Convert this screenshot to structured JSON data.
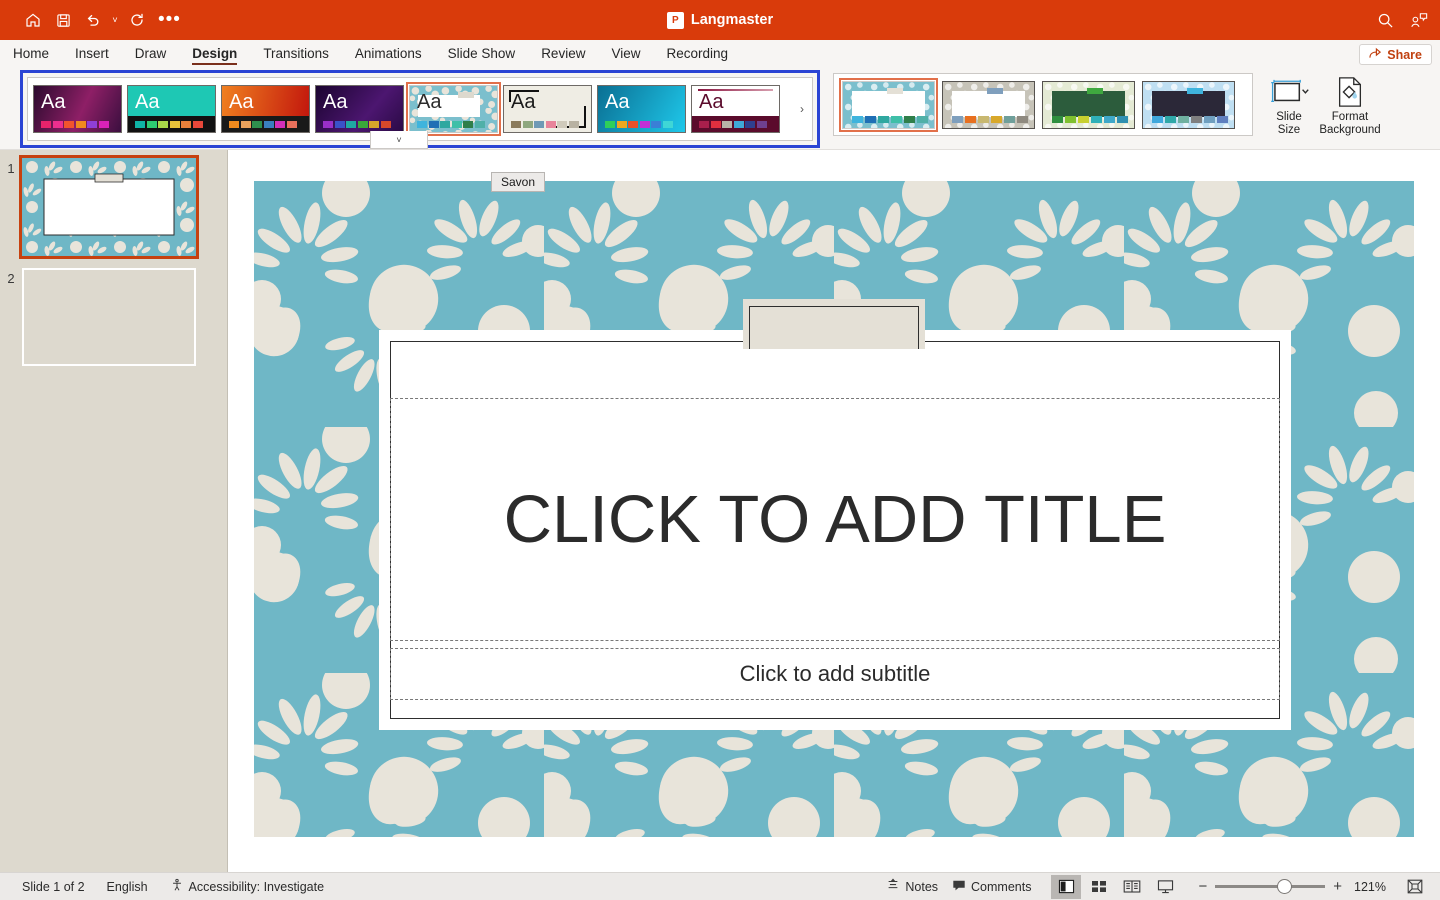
{
  "titlebar": {
    "title": "Langmaster",
    "app_icon": "powerpoint-icon",
    "quick_access": [
      {
        "name": "home-icon",
        "label": "Home"
      },
      {
        "name": "save-icon",
        "label": "Save"
      },
      {
        "name": "undo-icon",
        "label": "Undo"
      },
      {
        "name": "undo-dropdown-caret",
        "label": "˅"
      },
      {
        "name": "redo-icon",
        "label": "Redo"
      },
      {
        "name": "more-options-icon",
        "label": "•••"
      }
    ],
    "right_icons": [
      {
        "name": "search-icon",
        "label": "Search"
      },
      {
        "name": "collaborators-icon",
        "label": "Collaborators"
      }
    ],
    "bg_color": "#d93b0b"
  },
  "tabs": [
    {
      "label": "Home",
      "active": false
    },
    {
      "label": "Insert",
      "active": false
    },
    {
      "label": "Draw",
      "active": false
    },
    {
      "label": "Design",
      "active": true
    },
    {
      "label": "Transitions",
      "active": false
    },
    {
      "label": "Animations",
      "active": false
    },
    {
      "label": "Slide Show",
      "active": false
    },
    {
      "label": "Review",
      "active": false
    },
    {
      "label": "View",
      "active": false
    },
    {
      "label": "Recording",
      "active": false
    }
  ],
  "share": {
    "label": "Share",
    "icon": "share-icon",
    "color": "#c0400f"
  },
  "ribbon": {
    "themes": {
      "focused": true,
      "focus_ring_color": "#2b44d4",
      "sample_text": "Aa",
      "more_caret": "˅",
      "next_arrow": "›",
      "tooltip": "Savon",
      "items": [
        {
          "name": "theme-berry",
          "bg": "linear-gradient(115deg,#2b0a2e,#8e1f66 55%,#3b0f3f)",
          "aa_color": "#ffffff",
          "swatches": [
            "#e8236b",
            "#ec2f8e",
            "#f2542d",
            "#f08a1e",
            "#8f3fd6",
            "#d922b8"
          ]
        },
        {
          "name": "theme-teal-facet",
          "bg": "#1ec8b4",
          "aa_color": "#ffffff",
          "swatches": [
            "#0fb5a5",
            "#2ecc71",
            "#a8d84a",
            "#e8c23a",
            "#e8803a",
            "#e8483a"
          ],
          "band": "#111111"
        },
        {
          "name": "theme-orange-ion",
          "bg": "linear-gradient(100deg,#f08020,#c1140c)",
          "aa_color": "#ffffff",
          "swatches": [
            "#f08a1e",
            "#e8a15c",
            "#2f8f4e",
            "#3a7fbf",
            "#d22fb8",
            "#e8705c"
          ],
          "band": "#191919"
        },
        {
          "name": "theme-purple-gallery",
          "bg": "linear-gradient(130deg,#1b0430,#4c1670 60%,#2a0a45)",
          "aa_color": "#ffffff",
          "swatches": [
            "#9a2fc8",
            "#3a52c8",
            "#1fa9a2",
            "#3aa93a",
            "#d8a52a",
            "#d8482a"
          ]
        },
        {
          "name": "theme-savon",
          "bg": "#7bbfcd",
          "aa_color": "#2b2b2b",
          "selected": true,
          "swatches": [
            "#3fb4dd",
            "#1f6fb5",
            "#2fa8a0",
            "#3fbfa8",
            "#2f7f4a",
            "#4fb0a8"
          ]
        },
        {
          "name": "theme-quotable",
          "bg": "#efede4",
          "aa_color": "#1a1a1a",
          "swatches": [
            "#8a7b5c",
            "#8fa87f",
            "#6f9ab5",
            "#e8849a",
            "#cfcabb",
            "#b8b2a2"
          ]
        },
        {
          "name": "theme-cyan-vapor",
          "bg": "linear-gradient(120deg,#0a6f93,#1fc8ea)",
          "aa_color": "#ffffff",
          "swatches": [
            "#2fcf5a",
            "#f0a81e",
            "#e8502a",
            "#c22fd6",
            "#3a7fd6",
            "#3fd6d6"
          ]
        },
        {
          "name": "theme-maroon-wisp",
          "bg": "#ffffff",
          "aa_color": "#5b0b2c",
          "swatches": [
            "#a81f4c",
            "#e02f3f",
            "#b8b2a8",
            "#3fa8d6",
            "#2f3f8f",
            "#6f3f8f"
          ],
          "band": "#5b0b2c"
        }
      ]
    },
    "variants": {
      "items": [
        {
          "name": "variant-teal",
          "selected": true,
          "pattern": "#7bbfcd",
          "card": "#ffffff",
          "tab": "#e4e0d6",
          "swatches": [
            "#3fb4dd",
            "#1f6fb5",
            "#2fa8a0",
            "#3fbfa8",
            "#2f7f4a",
            "#4fb0a8"
          ]
        },
        {
          "name": "variant-gray",
          "selected": false,
          "pattern": "#c6c3b8",
          "card": "#ffffff",
          "tab": "#7f9fbd",
          "swatches": [
            "#7f9fbd",
            "#e87020",
            "#c8b870",
            "#d8a82a",
            "#6f9f9a",
            "#8f8a80"
          ]
        },
        {
          "name": "variant-green",
          "selected": false,
          "pattern": "#e4ead4",
          "card": "#2c5c3c",
          "tab": "#3fa83f",
          "swatches": [
            "#2f8f3f",
            "#7fc02f",
            "#c8d02f",
            "#2fb0b8",
            "#3fa8c8",
            "#2f8fb0"
          ]
        },
        {
          "name": "variant-navy",
          "selected": false,
          "pattern": "#bfdff2",
          "card": "#2b2838",
          "tab": "#3fb4dd",
          "swatches": [
            "#3fa8dd",
            "#2fa8a8",
            "#6fb0a0",
            "#7f7f7f",
            "#6f9fbf",
            "#5f7fbf"
          ]
        }
      ]
    },
    "slide_size": {
      "label_line1": "Slide",
      "label_line2": "Size",
      "icon": "slide-size-icon",
      "caret": "˅"
    },
    "format_background": {
      "label_line1": "Format",
      "label_line2": "Background",
      "icon": "format-background-icon"
    }
  },
  "thumbnails": [
    {
      "number": "1",
      "selected": true,
      "name": "slide-thumbnail-1"
    },
    {
      "number": "2",
      "selected": false,
      "name": "slide-thumbnail-2"
    }
  ],
  "slide": {
    "theme_name": "Savon",
    "bg_color": "#6fb7c6",
    "motif_color": "#e8e4da",
    "title_placeholder": "CLICK TO ADD TITLE",
    "subtitle_placeholder": "Click to add subtitle"
  },
  "statusbar": {
    "slide_counter": "Slide 1 of 2",
    "language": "English",
    "accessibility": "Accessibility: Investigate",
    "accessibility_icon": "accessibility-icon",
    "notes": "Notes",
    "notes_icon": "notes-icon",
    "comments": "Comments",
    "comments_icon": "comments-icon",
    "views": [
      {
        "name": "view-normal",
        "label": "Normal",
        "active": true
      },
      {
        "name": "view-slide-sorter",
        "label": "Slide Sorter",
        "active": false
      },
      {
        "name": "view-reading",
        "label": "Reading View",
        "active": false
      },
      {
        "name": "view-slide-show",
        "label": "Slide Show",
        "active": false
      }
    ],
    "zoom_out": "−",
    "zoom_in": "+",
    "zoom_level": "121%",
    "fit_icon": "fit-to-window-icon"
  }
}
